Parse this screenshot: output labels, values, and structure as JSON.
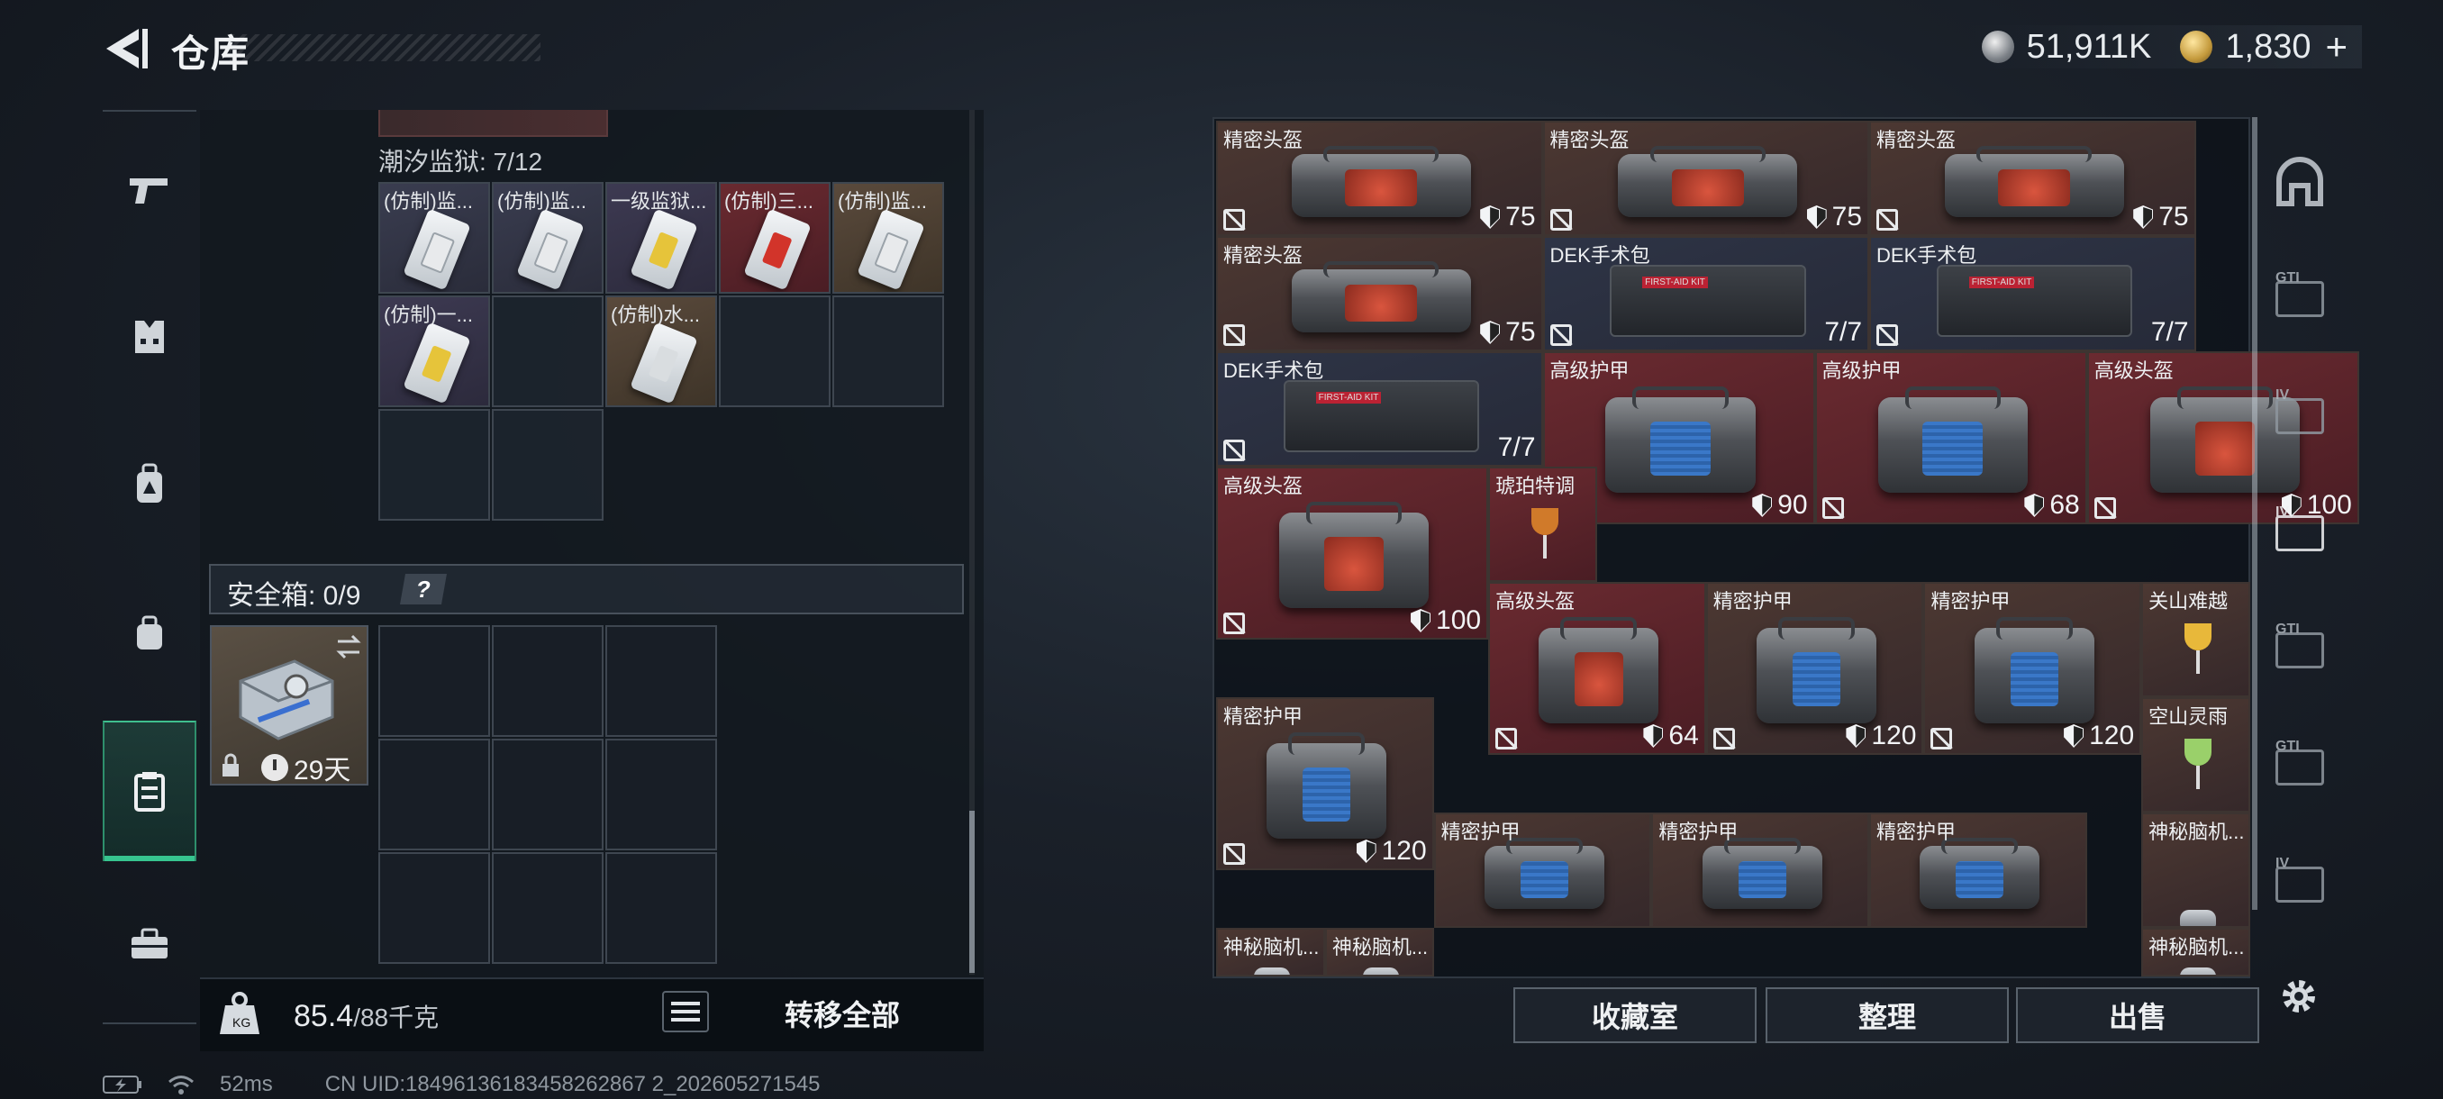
{
  "header": {
    "title": "仓库"
  },
  "currency": {
    "silver": "51,911K",
    "gold": "1,830",
    "plus": "+"
  },
  "left_nav": [
    "gun-icon",
    "armor-icon",
    "backpack-icon",
    "bag-icon",
    "safebox-icon",
    "toolbox-icon"
  ],
  "prison": {
    "title": "潮汐监狱: 7/12",
    "cells": [
      {
        "label": "(仿制)监...",
        "card": "white"
      },
      {
        "label": "(仿制)监...",
        "card": "white"
      },
      {
        "label": "一级监狱...",
        "card": "yellow"
      },
      {
        "label": "(仿制)三...",
        "card": "red"
      },
      {
        "label": "(仿制)监...",
        "card": "white"
      },
      {
        "label": "(仿制)一...",
        "card": "yellow"
      },
      {
        "label": "",
        "card": ""
      },
      {
        "label": "(仿制)水...",
        "card": "pale"
      },
      {
        "label": "",
        "card": ""
      },
      {
        "label": "",
        "card": ""
      }
    ]
  },
  "safe": {
    "label": "安全箱: 0/9",
    "help": "?",
    "days": "29天"
  },
  "weight": {
    "current": "85.4",
    "max": "/88千克"
  },
  "transfer_all": "转移全部",
  "status": {
    "latency": "52ms",
    "uid": "CN UID:18496136183458262867 2_202605271545"
  },
  "items": [
    {
      "name": "精密头盔",
      "value": "75",
      "kind": "bag-red",
      "bg": "bg-brown"
    },
    {
      "name": "精密头盔",
      "value": "75",
      "kind": "bag-red",
      "bg": "bg-brown"
    },
    {
      "name": "精密头盔",
      "value": "75",
      "kind": "bag-red",
      "bg": "bg-brown"
    },
    {
      "name": "精密头盔",
      "value": "75",
      "kind": "bag-red",
      "bg": "bg-brown"
    },
    {
      "name": "DEK手术包",
      "value": "7/7",
      "kind": "kit",
      "bg": "bg-blue"
    },
    {
      "name": "DEK手术包",
      "value": "7/7",
      "kind": "kit",
      "bg": "bg-blue"
    },
    {
      "name": "DEK手术包",
      "value": "7/7",
      "kind": "kit",
      "bg": "bg-blue"
    },
    {
      "name": "高级护甲",
      "value": "90",
      "kind": "bag-blue",
      "bg": "bg-red"
    },
    {
      "name": "高级护甲",
      "value": "68",
      "kind": "bag-blue",
      "bg": "bg-red"
    },
    {
      "name": "高级头盔",
      "value": "100",
      "kind": "bag-red",
      "bg": "bg-red"
    },
    {
      "name": "高级头盔",
      "value": "100",
      "kind": "bag-red",
      "bg": "bg-red"
    },
    {
      "name": "琥珀特调",
      "value": "",
      "kind": "cocktail",
      "bg": "bg-red"
    },
    {
      "name": "高级头盔",
      "value": "64",
      "kind": "bag-red",
      "bg": "bg-red"
    },
    {
      "name": "精密护甲",
      "value": "120",
      "kind": "bag-blue",
      "bg": "bg-brown"
    },
    {
      "name": "精密护甲",
      "value": "120",
      "kind": "bag-blue",
      "bg": "bg-brown"
    },
    {
      "name": "关山难越",
      "value": "",
      "kind": "cocktail-yellow",
      "bg": "bg-brown"
    },
    {
      "name": "空山灵雨",
      "value": "",
      "kind": "cocktail-green",
      "bg": "bg-brown"
    },
    {
      "name": "精密护甲",
      "value": "120",
      "kind": "bag-blue",
      "bg": "bg-brown"
    },
    {
      "name": "精密护甲",
      "value": "",
      "kind": "bag-blue",
      "bg": "bg-brown"
    },
    {
      "name": "精密护甲",
      "value": "",
      "kind": "bag-blue",
      "bg": "bg-brown"
    },
    {
      "name": "精密护甲",
      "value": "",
      "kind": "bag-blue",
      "bg": "bg-brown"
    },
    {
      "name": "神秘脑机...",
      "value": "",
      "kind": "device",
      "bg": "bg-brown"
    },
    {
      "name": "神秘脑机...",
      "value": "",
      "kind": "device",
      "bg": "bg-brown"
    },
    {
      "name": "神秘脑机...",
      "value": "",
      "kind": "device",
      "bg": "bg-brown"
    },
    {
      "name": "神秘脑机...",
      "value": "",
      "kind": "device",
      "bg": "bg-brown"
    }
  ],
  "right_rail": [
    {
      "icon": "helmet-icon",
      "tag": ""
    },
    {
      "icon": "gti-icon",
      "tag": "GTI"
    },
    {
      "icon": "iv-icon",
      "tag": "IV"
    },
    {
      "icon": "iv-plus-icon",
      "tag": "IV"
    },
    {
      "icon": "gti-hand-icon",
      "tag": "GTI"
    },
    {
      "icon": "gti-settings-icon",
      "tag": "GTI"
    },
    {
      "icon": "iv-box-icon",
      "tag": "IV"
    }
  ],
  "buttons": {
    "collection": "收藏室",
    "sort": "整理",
    "sell": "出售"
  }
}
